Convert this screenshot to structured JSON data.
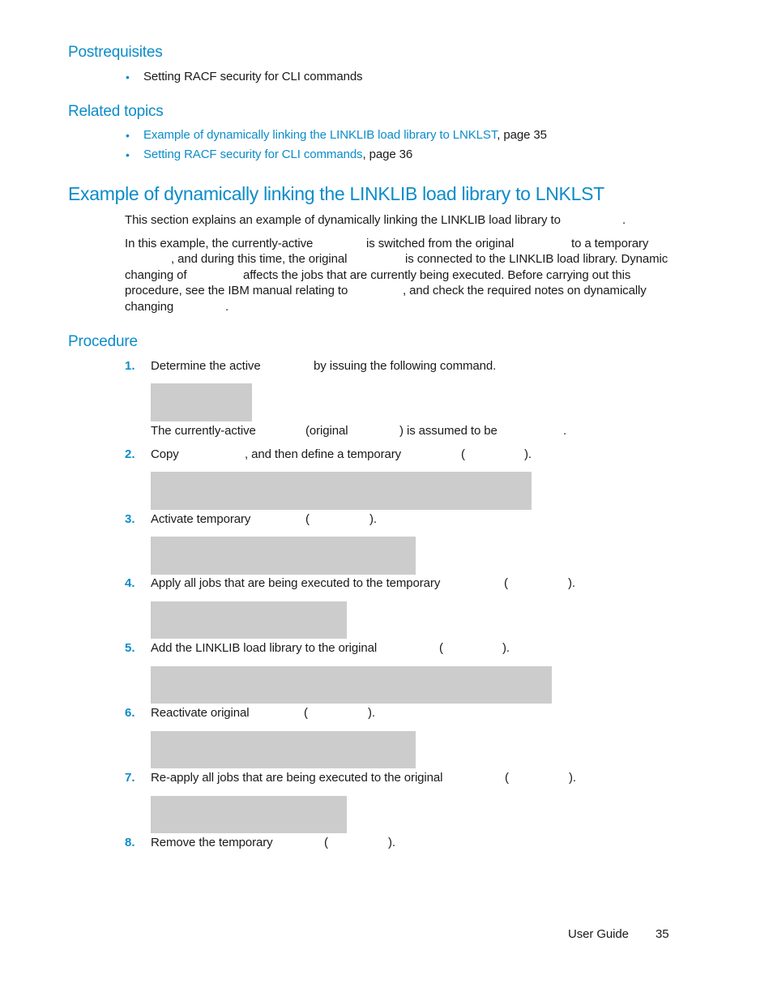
{
  "postrequisites": {
    "heading": "Postrequisites",
    "items": [
      "Setting RACF security for CLI commands"
    ]
  },
  "related_topics": {
    "heading": "Related topics",
    "items": [
      {
        "link": "Example of dynamically linking the LINKLIB load library to LNKLST",
        "suffix": ", page 35"
      },
      {
        "link": "Setting RACF security for CLI commands",
        "suffix": ", page 36"
      }
    ]
  },
  "section": {
    "title": "Example of dynamically linking the LINKLIB load library to LNKLST",
    "intro": {
      "a": "This section explains an example of dynamically linking the LINKLIB load library to",
      "b": "."
    },
    "para": {
      "l1a": "In this example, the currently-active",
      "l1b": "is switched from the original",
      "l1c": "to a temporary",
      "l2a": ", and during this time, the original",
      "l2b": "is connected to the LINKLIB load library. Dynamic",
      "l3a": "changing of",
      "l3b": "affects the jobs that are currently being executed. Before carrying out this",
      "l4a": "procedure, see the IBM manual relating to",
      "l4b": ", and check the required notes on dynamically",
      "l5a": "changing",
      "l5b": "."
    }
  },
  "procedure": {
    "heading": "Procedure",
    "steps": [
      {
        "num": "1.",
        "a": "Determine the active",
        "b": "by issuing the following command.",
        "note": {
          "a": "The currently-active",
          "b": "(original",
          "c": ") is assumed to be",
          "d": "."
        }
      },
      {
        "num": "2.",
        "a": "Copy",
        "b": ", and then define a temporary",
        "c": "(",
        "d": ")."
      },
      {
        "num": "3.",
        "a": "Activate temporary",
        "c": "(",
        "d": ")."
      },
      {
        "num": "4.",
        "a": "Apply all jobs that are being executed to the temporary",
        "c": "(",
        "d": ")."
      },
      {
        "num": "5.",
        "a": "Add the LINKLIB load library to the original",
        "c": "(",
        "d": ")."
      },
      {
        "num": "6.",
        "a": "Reactivate original",
        "c": "(",
        "d": ")."
      },
      {
        "num": "7.",
        "a": "Re-apply all jobs that are being executed to the original",
        "c": "(",
        "d": ")."
      },
      {
        "num": "8.",
        "a": "Remove the temporary",
        "c": "(",
        "d": ")."
      }
    ]
  },
  "footer": {
    "label": "User Guide",
    "page": "35"
  }
}
